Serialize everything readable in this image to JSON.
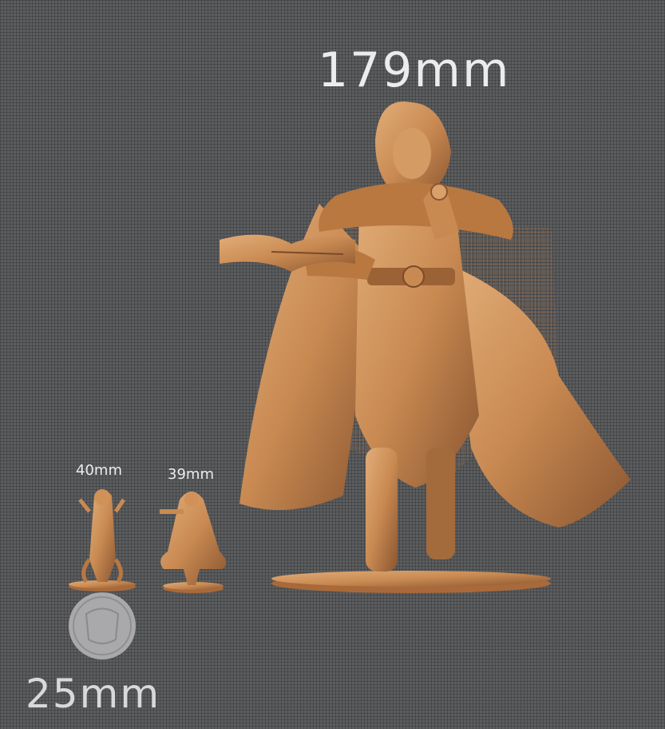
{
  "labels": {
    "large": "179mm",
    "medium": "40mm",
    "small": "39mm",
    "base": "25mm"
  },
  "colors": {
    "background": "#5c5d5f",
    "resin": "#c98a52",
    "resin_dark": "#8a5530",
    "resin_light": "#e2ad79",
    "text": "#ececec",
    "coin": "#a9a9ab"
  }
}
